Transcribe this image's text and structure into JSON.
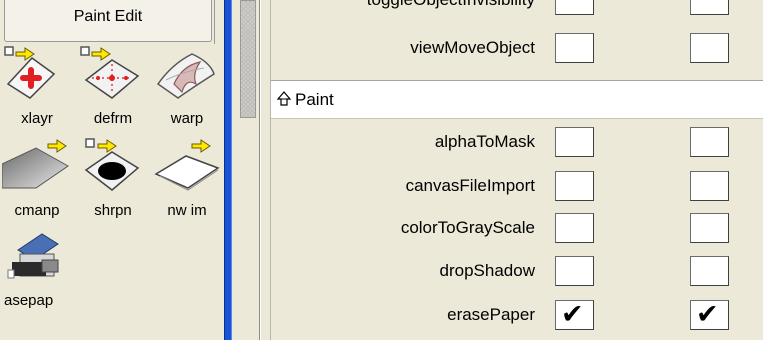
{
  "palette": {
    "tab_title": "Paint Edit",
    "tools": [
      {
        "label": "xlayr",
        "icon": "transform-layer-icon"
      },
      {
        "label": "defrm",
        "icon": "deform-icon"
      },
      {
        "label": "warp",
        "icon": "warp-icon"
      },
      {
        "label": "cmanp",
        "icon": "color-manipulation-icon"
      },
      {
        "label": "shrpn",
        "icon": "sharpen-icon"
      },
      {
        "label": "nw im",
        "icon": "new-image-icon"
      },
      {
        "label": "asepap",
        "icon": "erase-paper-icon"
      }
    ]
  },
  "grid": {
    "rows_above": [
      {
        "name": "toggleObjectInvisibility",
        "col1_checked": false,
        "col2_checked": false
      },
      {
        "name": "viewMoveObject",
        "col1_checked": false,
        "col2_checked": false
      }
    ],
    "section": {
      "title": "Paint",
      "icon": "collapse-arrow-icon"
    },
    "rows": [
      {
        "name": "alphaToMask",
        "col1_checked": false,
        "col2_checked": false
      },
      {
        "name": "canvasFileImport",
        "col1_checked": false,
        "col2_checked": false
      },
      {
        "name": "colorToGrayScale",
        "col1_checked": false,
        "col2_checked": false
      },
      {
        "name": "dropShadow",
        "col1_checked": false,
        "col2_checked": false
      },
      {
        "name": "erasePaper",
        "col1_checked": true,
        "col2_checked": true
      }
    ]
  },
  "colors": {
    "splitter": "#1a53d8",
    "panel_bg": "#ece9d8",
    "badge_arrow": "#ffe800"
  }
}
